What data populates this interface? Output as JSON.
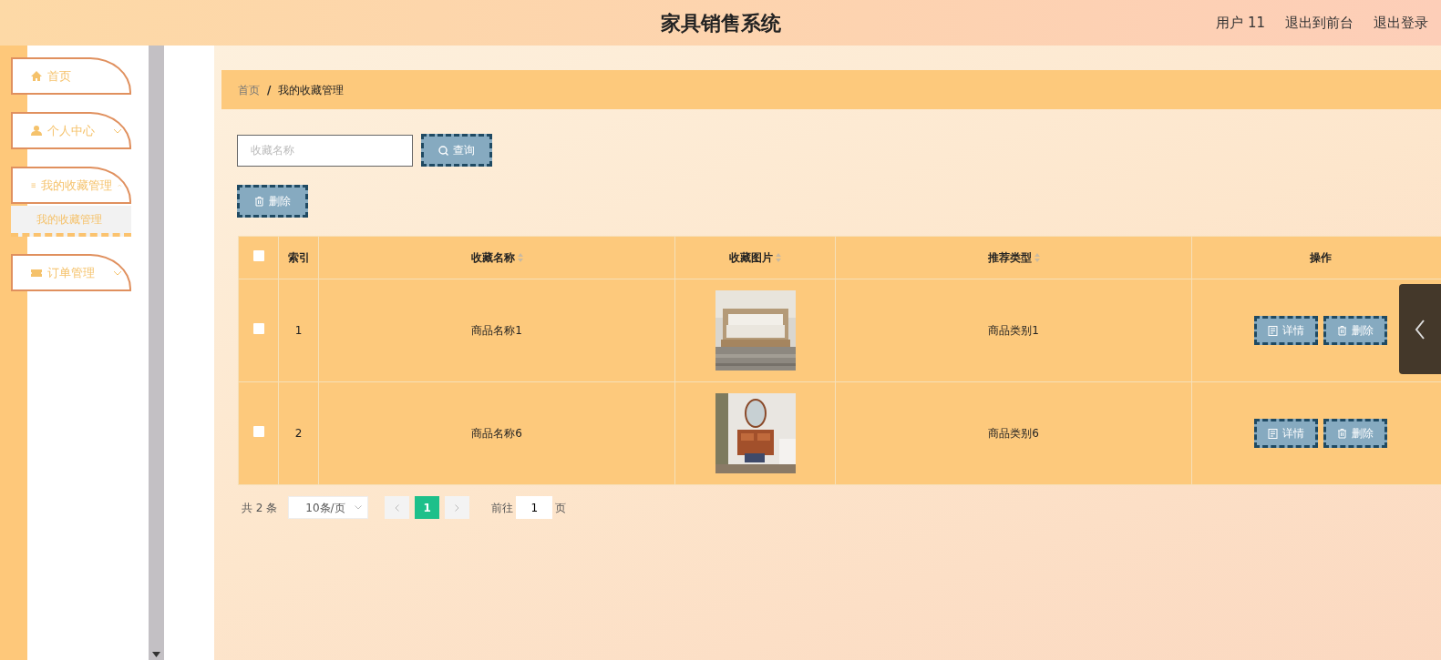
{
  "header": {
    "title": "家具销售系统",
    "links": [
      "用户 11",
      "退出到前台",
      "退出登录"
    ]
  },
  "sidebar": {
    "items": [
      {
        "label": "首页",
        "expandable": false
      },
      {
        "label": "个人中心",
        "expandable": true,
        "expanded": false
      },
      {
        "label": "我的收藏管理",
        "expandable": true,
        "expanded": true,
        "children": [
          {
            "label": "我的收藏管理",
            "selected": true
          }
        ]
      },
      {
        "label": "订单管理",
        "expandable": true,
        "expanded": false
      }
    ]
  },
  "breadcrumb": [
    "首页",
    "我的收藏管理"
  ],
  "breadcrumb_separator": "/",
  "search": {
    "placeholder": "收藏名称",
    "button": "查询"
  },
  "delete_button": "删除",
  "table": {
    "columns": [
      {
        "kind": "checkbox",
        "checked": false
      },
      {
        "kind": "text",
        "label": "索引",
        "sortable": false
      },
      {
        "kind": "text",
        "label": "收藏名称",
        "sortable": true
      },
      {
        "kind": "text",
        "label": "收藏图片",
        "sortable": true
      },
      {
        "kind": "text",
        "label": "推荐类型",
        "sortable": true
      },
      {
        "kind": "text",
        "label": "操作",
        "sortable": false
      }
    ],
    "rows": [
      {
        "checked": false,
        "index": "1",
        "name": "商品名称1",
        "image": {
          "kind": "picture"
        },
        "type": "商品类别1",
        "actions": [
          "详情",
          "删除"
        ]
      },
      {
        "checked": false,
        "index": "2",
        "name": "商品名称6",
        "image": {
          "kind": "picture"
        },
        "type": "商品类别6",
        "actions": [
          "详情",
          "删除"
        ]
      }
    ]
  },
  "pagination": {
    "total": "共 2 条",
    "page_size": "10条/页",
    "pages": [
      {
        "label": "1",
        "selected": true
      }
    ],
    "goto_label": "前往",
    "goto_value": "1",
    "goto_suffix": "页"
  }
}
